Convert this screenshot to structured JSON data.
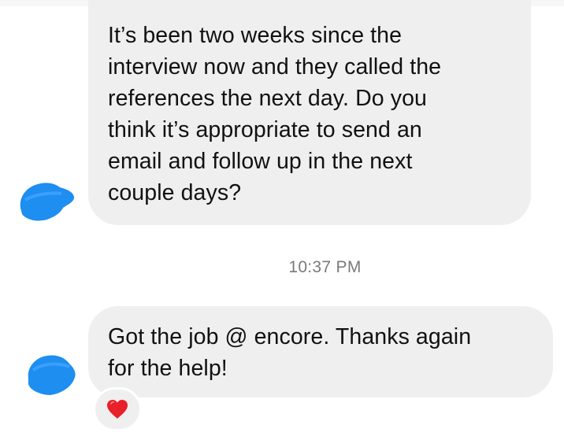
{
  "messages": [
    {
      "lines": [
        "It’s been two weeks since the",
        "interview now and they called the",
        "references the next day. Do you",
        "think it’s appropriate to send an",
        "email and follow up in the next",
        "couple days?"
      ]
    },
    {
      "lines": [
        "Got the job @ encore. Thanks again",
        "for the help!"
      ],
      "reaction": "heart-icon"
    }
  ],
  "timestamp": "10:37 PM",
  "colors": {
    "bubble": "#efefef",
    "avatar_scribble": "#1e8ef0",
    "heart": "#e8202a"
  }
}
